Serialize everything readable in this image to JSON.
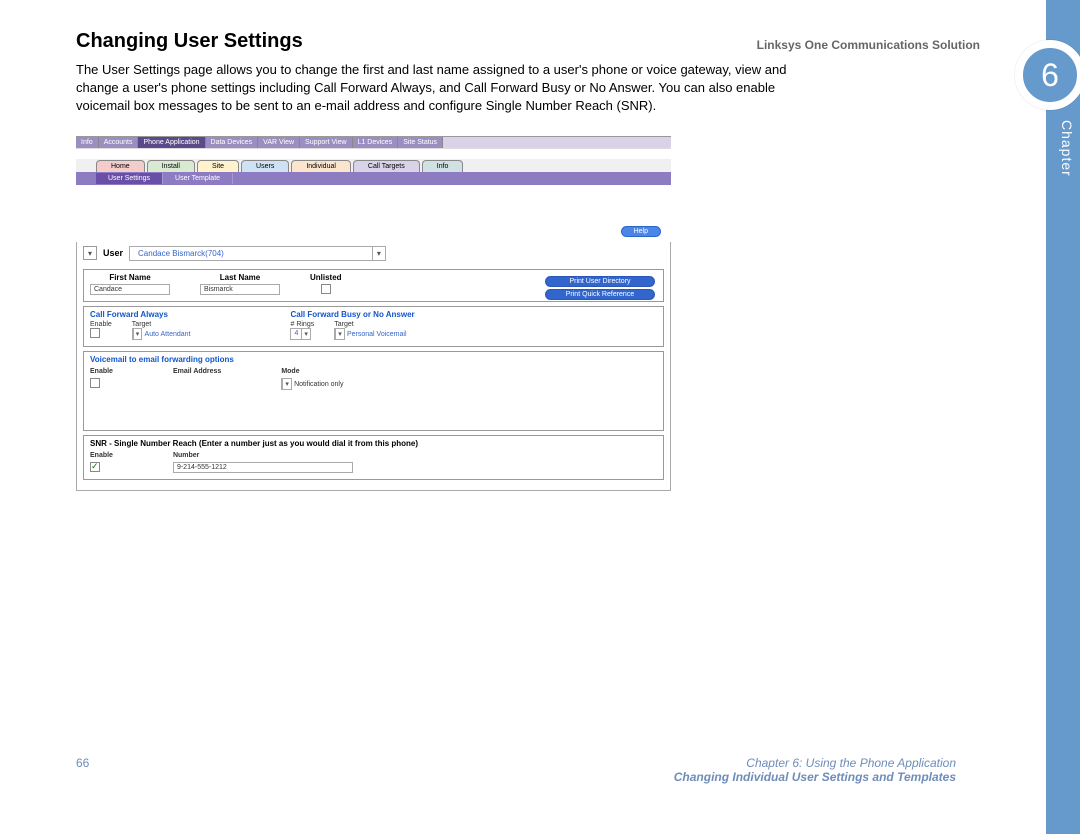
{
  "header": {
    "product": "Linksys One Communications Solution"
  },
  "chapter": {
    "number": "6",
    "label": "Chapter"
  },
  "title": "Changing User Settings",
  "intro": "The User Settings page allows you to change the first and last name assigned to a user's phone or voice gateway, view and change a user's phone settings including Call Forward Always, and Call Forward Busy or No Answer. You can also enable voicemail box messages to be sent to an e-mail address and configure Single Number Reach (SNR).",
  "primary_tabs": [
    "Info",
    "Accounts",
    "Phone Application",
    "Data Devices",
    "VAR View",
    "Support View",
    "L1 Devices",
    "Site Status"
  ],
  "secondary_tabs": [
    "Home",
    "Install",
    "Site",
    "Users",
    "Individual",
    "Call Targets",
    "Info"
  ],
  "tertiary_tabs": [
    "User Settings",
    "User Template"
  ],
  "help_label": "Help",
  "user_row": {
    "label": "User",
    "value": "Candace Bismarck(704)"
  },
  "name_panel": {
    "first_label": "First Name",
    "first_value": "Candace",
    "last_label": "Last Name",
    "last_value": "Bismarck",
    "unlisted_label": "Unlisted",
    "pill1": "Print User Directory",
    "pill2": "Print Quick Reference"
  },
  "forward_panel": {
    "cfa_title": "Call Forward Always",
    "cfb_title": "Call Forward Busy or No Answer",
    "enable_label": "Enable",
    "target_label": "Target",
    "rings_label": "# Rings",
    "cfa_target": "Auto Attendant",
    "rings_value": "4",
    "cfb_target": "Personal Voicemail"
  },
  "vm_panel": {
    "title": "Voicemail to email forwarding options",
    "enable_label": "Enable",
    "email_label": "Email Address",
    "mode_label": "Mode",
    "mode_value": "Notification only"
  },
  "snr_panel": {
    "title": "SNR - Single Number Reach (Enter a number just as you would dial it from this phone)",
    "enable_label": "Enable",
    "number_label": "Number",
    "number_value": "9-214-555-1212"
  },
  "footer": {
    "page": "66",
    "line1": "Chapter 6: Using the Phone Application",
    "line2": "Changing Individual User Settings and Templates"
  }
}
